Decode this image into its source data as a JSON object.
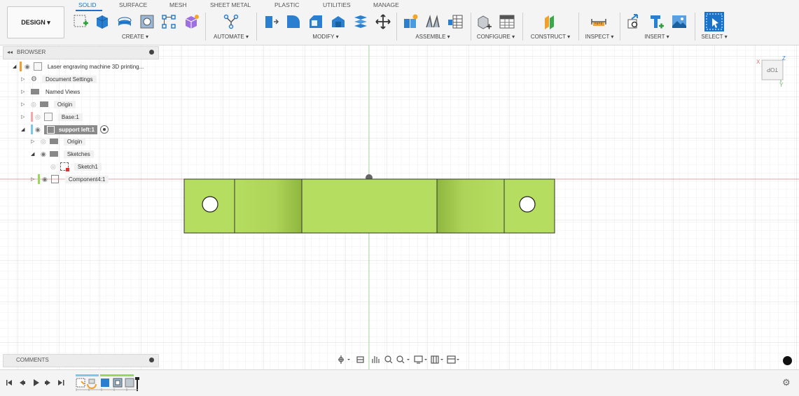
{
  "workspace": {
    "label": "DESIGN ▾"
  },
  "tabs": [
    "SOLID",
    "SURFACE",
    "MESH",
    "SHEET METAL",
    "PLASTIC",
    "UTILITIES",
    "MANAGE"
  ],
  "groups": {
    "create": "CREATE ▾",
    "automate": "AUTOMATE ▾",
    "modify": "MODIFY ▾",
    "assemble": "ASSEMBLE ▾",
    "configure": "CONFIGURE ▾",
    "construct": "CONSTRUCT ▾",
    "inspect": "INSPECT ▾",
    "insert": "INSERT ▾",
    "select": "SELECT ▾"
  },
  "browser": {
    "title": "BROWSER",
    "root": "Laser engraving machine 3D printing...",
    "items": {
      "document_settings": "Document Settings",
      "named_views": "Named Views",
      "origin": "Origin",
      "base": "Base:1",
      "support_left": "support left:1",
      "sub_origin": "Origin",
      "sketches": "Sketches",
      "sketch1": "Sketch1",
      "component4": "Component4:1"
    }
  },
  "comments": {
    "title": "COMMENTS"
  },
  "viewcube": {
    "face": "TOP",
    "axis_x": "X",
    "axis_y": "Y",
    "axis_z": "Z"
  },
  "colors": {
    "accent": "#1a73c8",
    "part_fill": "#b5dd5f",
    "part_dark": "#8fb63f",
    "x_axis": "#e8a3a3",
    "y_axis": "#a8dba8",
    "highlight": "#8a8a8a"
  }
}
